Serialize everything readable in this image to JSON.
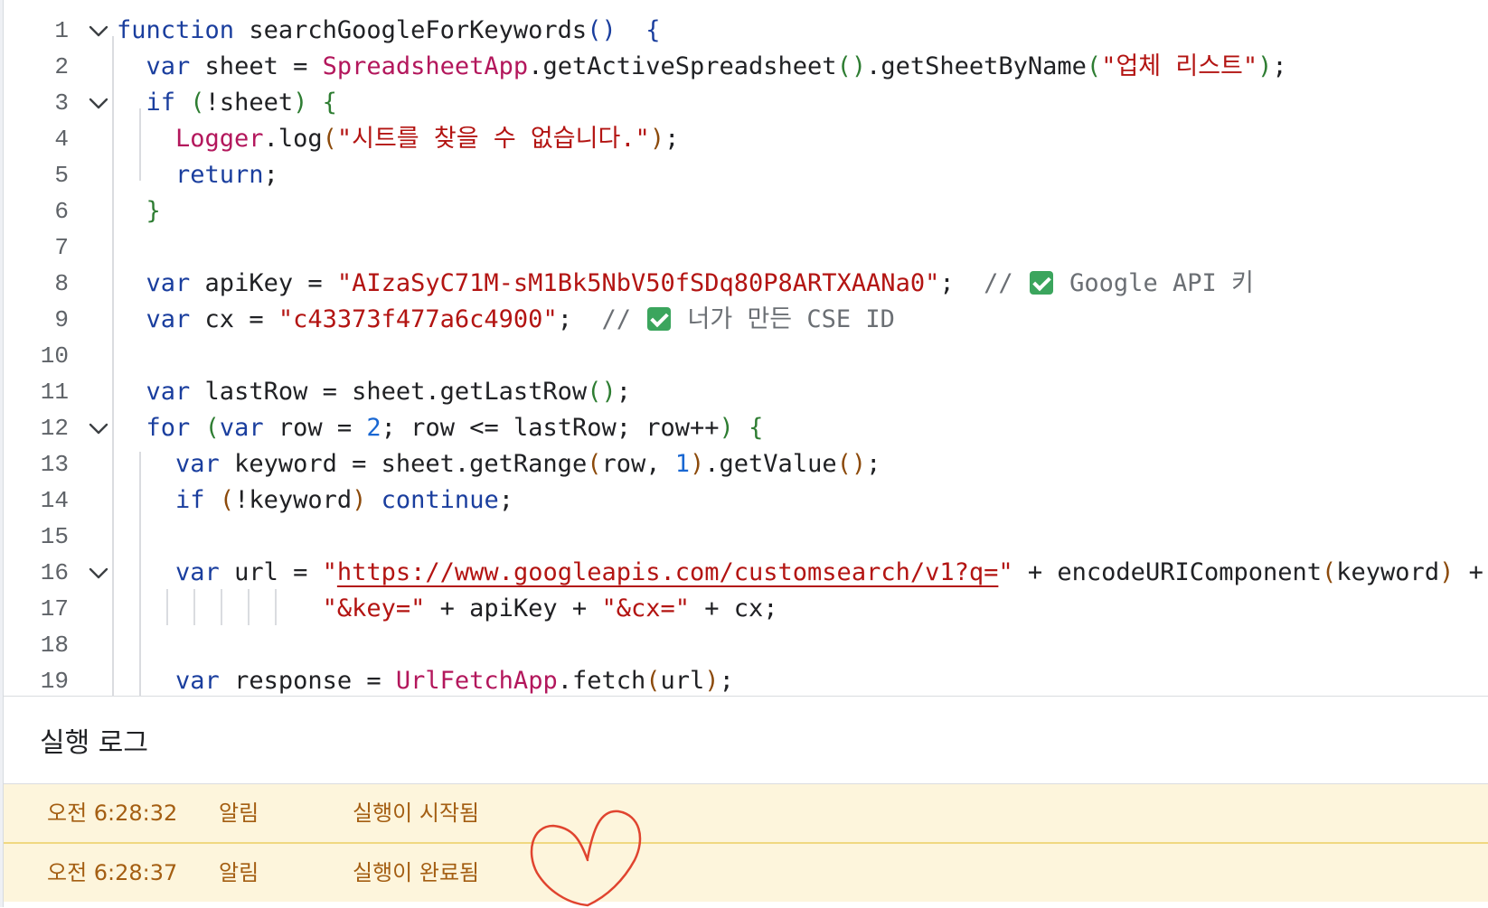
{
  "editor": {
    "lines": [
      {
        "num": "1",
        "fold": true,
        "tokens": [
          [
            "kw",
            "function "
          ],
          [
            "fn",
            "searchGoogleForKeywords"
          ],
          [
            "p1",
            "()"
          ],
          [
            "",
            "  "
          ],
          [
            "p1",
            "{"
          ]
        ]
      },
      {
        "num": "2",
        "fold": false,
        "tokens": [
          [
            "",
            "  "
          ],
          [
            "kw",
            "var"
          ],
          [
            "",
            " sheet = "
          ],
          [
            "cls",
            "SpreadsheetApp"
          ],
          [
            "",
            ".getActiveSpreadsheet"
          ],
          [
            "p2",
            "()"
          ],
          [
            "",
            ".getSheetByName"
          ],
          [
            "p2",
            "("
          ],
          [
            "str",
            "\"업체 리스트\""
          ],
          [
            "p2",
            ")"
          ],
          [
            "",
            ";"
          ]
        ]
      },
      {
        "num": "3",
        "fold": true,
        "tokens": [
          [
            "",
            "  "
          ],
          [
            "kw",
            "if"
          ],
          [
            "",
            " "
          ],
          [
            "p2",
            "("
          ],
          [
            "",
            "!sheet"
          ],
          [
            "p2",
            ")"
          ],
          [
            "",
            " "
          ],
          [
            "p2",
            "{"
          ]
        ]
      },
      {
        "num": "4",
        "fold": false,
        "tokens": [
          [
            "",
            "    "
          ],
          [
            "cls",
            "Logger"
          ],
          [
            "",
            ".log"
          ],
          [
            "p3",
            "("
          ],
          [
            "str",
            "\"시트를 찾을 수 없습니다.\""
          ],
          [
            "p3",
            ")"
          ],
          [
            "",
            ";"
          ]
        ]
      },
      {
        "num": "5",
        "fold": false,
        "tokens": [
          [
            "",
            "    "
          ],
          [
            "kw",
            "return"
          ],
          [
            "",
            ";"
          ]
        ]
      },
      {
        "num": "6",
        "fold": false,
        "tokens": [
          [
            "",
            "  "
          ],
          [
            "p2",
            "}"
          ]
        ]
      },
      {
        "num": "7",
        "fold": false,
        "tokens": []
      },
      {
        "num": "8",
        "fold": false,
        "tokens": [
          [
            "",
            "  "
          ],
          [
            "kw",
            "var"
          ],
          [
            "",
            " apiKey = "
          ],
          [
            "str",
            "\"AIzaSyC71M-sM1Bk5NbV50fSDq80P8ARTXAANa0\""
          ],
          [
            "",
            ";  "
          ],
          [
            "com",
            "// "
          ],
          [
            "check",
            ""
          ],
          [
            "com",
            " Google API 키"
          ]
        ]
      },
      {
        "num": "9",
        "fold": false,
        "tokens": [
          [
            "",
            "  "
          ],
          [
            "kw",
            "var"
          ],
          [
            "",
            " cx = "
          ],
          [
            "str",
            "\"c43373f477a6c4900\""
          ],
          [
            "",
            ";  "
          ],
          [
            "com",
            "// "
          ],
          [
            "check",
            ""
          ],
          [
            "com",
            " 너가 만든 CSE ID"
          ]
        ]
      },
      {
        "num": "10",
        "fold": false,
        "tokens": []
      },
      {
        "num": "11",
        "fold": false,
        "tokens": [
          [
            "",
            "  "
          ],
          [
            "kw",
            "var"
          ],
          [
            "",
            " lastRow = sheet.getLastRow"
          ],
          [
            "p2",
            "()"
          ],
          [
            "",
            ";"
          ]
        ]
      },
      {
        "num": "12",
        "fold": true,
        "tokens": [
          [
            "",
            "  "
          ],
          [
            "kw",
            "for"
          ],
          [
            "",
            " "
          ],
          [
            "p2",
            "("
          ],
          [
            "kw",
            "var"
          ],
          [
            "",
            " row = "
          ],
          [
            "num",
            "2"
          ],
          [
            "",
            "; row <= lastRow; row++"
          ],
          [
            "p2",
            ")"
          ],
          [
            "",
            " "
          ],
          [
            "p2",
            "{"
          ]
        ]
      },
      {
        "num": "13",
        "fold": false,
        "tokens": [
          [
            "",
            "    "
          ],
          [
            "kw",
            "var"
          ],
          [
            "",
            " keyword = sheet.getRange"
          ],
          [
            "p3",
            "("
          ],
          [
            "",
            "row, "
          ],
          [
            "num",
            "1"
          ],
          [
            "p3",
            ")"
          ],
          [
            "",
            ".getValue"
          ],
          [
            "p3",
            "()"
          ],
          [
            "",
            ";"
          ]
        ]
      },
      {
        "num": "14",
        "fold": false,
        "tokens": [
          [
            "",
            "    "
          ],
          [
            "kw",
            "if"
          ],
          [
            "",
            " "
          ],
          [
            "p3",
            "("
          ],
          [
            "",
            "!keyword"
          ],
          [
            "p3",
            ")"
          ],
          [
            "",
            " "
          ],
          [
            "kw",
            "continue"
          ],
          [
            "",
            ";"
          ]
        ]
      },
      {
        "num": "15",
        "fold": false,
        "tokens": []
      },
      {
        "num": "16",
        "fold": true,
        "tokens": [
          [
            "",
            "    "
          ],
          [
            "kw",
            "var"
          ],
          [
            "",
            " url = "
          ],
          [
            "str",
            "\""
          ],
          [
            "strlink",
            "https://www.googleapis.com/customsearch/v1?q="
          ],
          [
            "str",
            "\""
          ],
          [
            "",
            " + encodeURIComponent"
          ],
          [
            "p3",
            "("
          ],
          [
            "",
            "keyword"
          ],
          [
            "p3",
            ")"
          ],
          [
            "",
            " +"
          ]
        ]
      },
      {
        "num": "17",
        "fold": false,
        "tokens": [
          [
            "",
            "              "
          ],
          [
            "str",
            "\"&key=\""
          ],
          [
            "",
            " + apiKey + "
          ],
          [
            "str",
            "\"&cx=\""
          ],
          [
            "",
            " + cx;"
          ]
        ]
      },
      {
        "num": "18",
        "fold": false,
        "tokens": []
      },
      {
        "num": "19",
        "fold": false,
        "tokens": [
          [
            "",
            "    "
          ],
          [
            "kw",
            "var"
          ],
          [
            "",
            " response = "
          ],
          [
            "cls",
            "UrlFetchApp"
          ],
          [
            "",
            ".fetch"
          ],
          [
            "p3",
            "("
          ],
          [
            "",
            "url"
          ],
          [
            "p3",
            ")"
          ],
          [
            "",
            ";"
          ]
        ]
      }
    ]
  },
  "log": {
    "title": "실행 로그",
    "entries": [
      {
        "time": "오전 6:28:32",
        "level": "알림",
        "message": "실행이 시작됨"
      },
      {
        "time": "오전 6:28:37",
        "level": "알림",
        "message": "실행이 완료됨"
      }
    ]
  },
  "colors": {
    "keyword": "#1a3e9e",
    "string": "#b31412",
    "class": "#b3175c",
    "number": "#1967d2",
    "comment": "#6b6f74",
    "log_row_bg": "#fdf5dc",
    "log_text": "#a45e12",
    "annotation": "#e0442f"
  },
  "icons": {
    "fold": "chevron-down-icon",
    "comment_mark": "check-mark-icon",
    "annotation": "hand-drawn-heart"
  }
}
